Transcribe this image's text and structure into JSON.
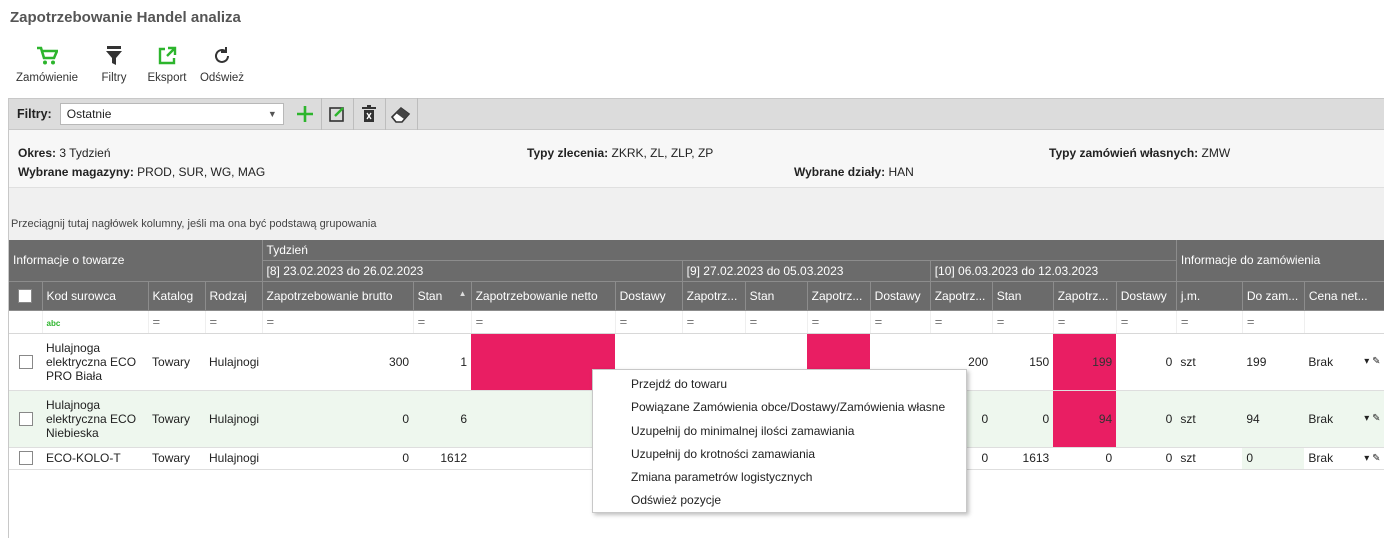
{
  "title": "Zapotrzebowanie Handel analiza",
  "toolbar": {
    "order_label": "Zamówienie",
    "filters_label": "Filtry",
    "export_label": "Eksport",
    "refresh_label": "Odśwież"
  },
  "colors": {
    "accent": "#2db52d",
    "hot": "#e91e63",
    "header": "#6b6b6b"
  },
  "filterbar": {
    "label": "Filtry:",
    "selected": "Ostatnie"
  },
  "info": {
    "okres_k": "Okres:",
    "okres_v": "3 Tydzień",
    "mag_k": "Wybrane magazyny:",
    "mag_v": "PROD, SUR, WG, MAG",
    "typy_k": "Typy zlecenia:",
    "typy_v": "ZKRK, ZL, ZLP, ZP",
    "dzialy_k": "Wybrane działy:",
    "dzialy_v": "HAN",
    "zam_k": "Typy zamówień własnych:",
    "zam_v": "ZMW"
  },
  "grouping_hint": "Przeciągnij tutaj nagłówek kolumny, jeśli ma ona być podstawą grupowania",
  "headers": {
    "info_towar": "Informacje o towarze",
    "tydzien": "Tydzień",
    "week8": "[8] 23.02.2023 do 26.02.2023",
    "week9": "[9] 27.02.2023 do 05.03.2023",
    "week10": "[10] 06.03.2023 do 12.03.2023",
    "info_zam": "Informacje do zamówienia",
    "kod": "Kod surowca",
    "katalog": "Katalog",
    "rodzaj": "Rodzaj",
    "zb": "Zapotrzebowanie brutto",
    "stan": "Stan",
    "zn": "Zapotrzebowanie netto",
    "dostawy": "Dostawy",
    "zap_short": "Zapotrz...",
    "zap_short2": "Zapotrz...",
    "zap_short3": "Zapotrz...",
    "zap_short4": "Zapotrz...",
    "stan9": "Stan",
    "dost9": "Dostawy",
    "stan10": "Stan",
    "dost10": "Dostawy",
    "jm": "j.m.",
    "dozam": "Do zam...",
    "cena": "Cena net..."
  },
  "filter_row": {
    "abc": "abc",
    "eq": "="
  },
  "rows": [
    {
      "kod": "Hulajnoga elektryczna ECO PRO Biała",
      "kod_l1": "Hulajnoga",
      "kod_l2": "elektryczna ECO",
      "kod_l3": "PRO Biała",
      "katalog": "Towary",
      "rodzaj": "Hulajnogi",
      "zb": "300",
      "stan": "1",
      "w10_zap": "200",
      "w10_stan": "150",
      "w10_zn": "199",
      "w10_dost": "0",
      "jm": "szt",
      "dozam": "199",
      "cena": "Brak"
    },
    {
      "kod": "Hulajnoga elektryczna ECO Niebieska",
      "kod_l1": "Hulajnoga",
      "kod_l2": "elektryczna ECO",
      "kod_l3": "Niebieska",
      "katalog": "Towary",
      "rodzaj": "Hulajnogi",
      "zb": "0",
      "stan": "6",
      "w10_zap": "0",
      "w10_stan": "0",
      "w10_zn": "94",
      "w10_dost": "0",
      "jm": "szt",
      "dozam": "94",
      "cena": "Brak"
    },
    {
      "kod": "ECO-KOLO-T",
      "katalog": "Towary",
      "rodzaj": "Hulajnogi",
      "zb": "0",
      "stan": "1612",
      "w10_zap": "0",
      "w10_stan": "1613",
      "w10_zn": "0",
      "w10_dost": "0",
      "jm": "szt",
      "dozam": "0",
      "cena": "Brak"
    }
  ],
  "context_menu": [
    "Przejdź do towaru",
    "Powiązane Zamówienia obce/Dostawy/Zamówienia własne",
    "Uzupełnij do minimalnej ilości zamawiania",
    "Uzupełnij do krotności zamawiania",
    "Zmiana parametrów logistycznych",
    "Odśwież pozycje"
  ]
}
